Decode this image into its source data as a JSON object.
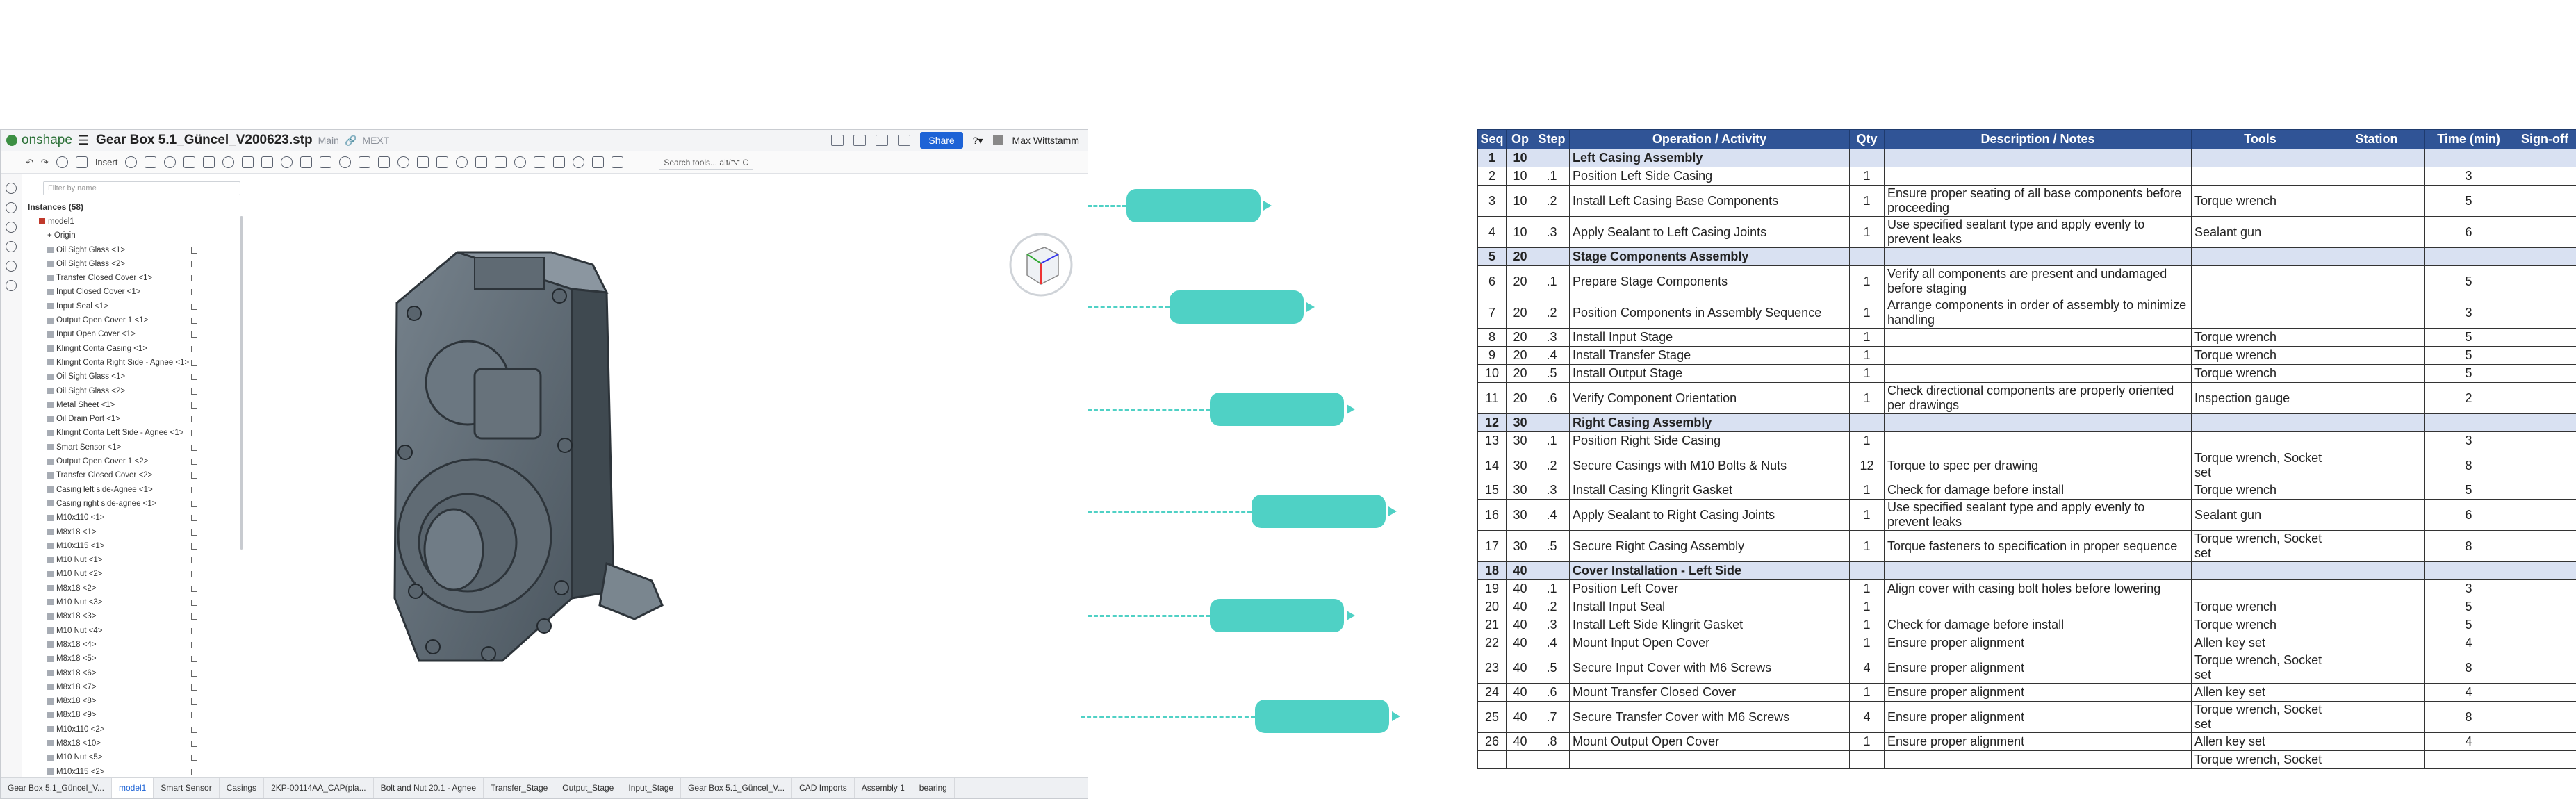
{
  "onshape": {
    "logo_text": "onshape",
    "doc_title": "Gear Box 5.1_Güncel_V200623.stp",
    "branch": "Main",
    "badge": "MEXT",
    "share": "Share",
    "user": "Max Wittstamm",
    "insert": "Insert",
    "search_tools": "Search tools...",
    "search_shortcut": "alt/⌥ C",
    "filter_placeholder": "Filter by name",
    "instances_label": "Instances (58)",
    "root": "model1",
    "origin": "Origin",
    "tree": [
      "Oil Sight Glass <1>",
      "Oil Sight Glass <2>",
      "Transfer Closed Cover <1>",
      "Input Closed Cover <1>",
      "Input Seal <1>",
      "Output Open Cover 1 <1>",
      "Input Open Cover <1>",
      "Klingrit Conta Casing <1>",
      "Klingrit Conta Right Side - Agnee <1>",
      "Oil Sight Glass <1>",
      "Oil Sight Glass <2>",
      "Metal Sheet <1>",
      "Oil Drain Port <1>",
      "Klingrit Conta Left Side - Agnee <1>",
      "Smart Sensor <1>",
      "Output Open Cover 1 <2>",
      "Transfer Closed Cover <2>",
      "Casing left side-Agnee <1>",
      "Casing right side-agnee <1>",
      "M10x110 <1>",
      "M8x18 <1>",
      "M10x115 <1>",
      "M10 Nut <1>",
      "M10 Nut <2>",
      "M8x18 <2>",
      "M10 Nut <3>",
      "M8x18 <3>",
      "M10 Nut <4>",
      "M8x18 <4>",
      "M8x18 <5>",
      "M8x18 <6>",
      "M8x18 <7>",
      "M8x18 <8>",
      "M8x18 <9>",
      "M10x110 <2>",
      "M8x18 <10>",
      "M10 Nut <5>",
      "M10x115 <2>"
    ],
    "tabs": [
      "Gear Box 5.1_Güncel_V...",
      "model1",
      "Smart Sensor",
      "Casings",
      "2KP-00114AA_CAP(pla...",
      "Bolt and Nut 20.1 - Agnee",
      "Transfer_Stage",
      "Output_Stage",
      "Input_Stage",
      "Gear Box 5.1_Güncel_V...",
      "CAD Imports",
      "Assembly 1",
      "bearing"
    ]
  },
  "table": {
    "headers": [
      "Seq",
      "Op",
      "Step",
      "Operation / Activity",
      "Qty",
      "Description / Notes",
      "Tools",
      "Station",
      "Time (min)",
      "Sign-off"
    ],
    "rows": [
      {
        "section": true,
        "seq": "1",
        "op": "10",
        "step": "",
        "activity": "Left Casing Assembly",
        "qty": "",
        "desc": "",
        "tools": "",
        "station": "",
        "time": "",
        "sign": ""
      },
      {
        "seq": "2",
        "op": "10",
        "step": ".1",
        "activity": "Position Left Side Casing",
        "qty": "1",
        "desc": "",
        "tools": "",
        "station": "",
        "time": "3",
        "sign": ""
      },
      {
        "seq": "3",
        "op": "10",
        "step": ".2",
        "activity": "Install Left Casing Base Components",
        "qty": "1",
        "desc": "Ensure proper seating of all base components before proceeding",
        "tools": "Torque wrench",
        "station": "",
        "time": "5",
        "sign": ""
      },
      {
        "seq": "4",
        "op": "10",
        "step": ".3",
        "activity": "Apply Sealant to Left Casing Joints",
        "qty": "1",
        "desc": "Use specified sealant type and apply evenly to prevent leaks",
        "tools": "Sealant gun",
        "station": "",
        "time": "6",
        "sign": ""
      },
      {
        "section": true,
        "seq": "5",
        "op": "20",
        "step": "",
        "activity": "Stage Components Assembly",
        "qty": "",
        "desc": "",
        "tools": "",
        "station": "",
        "time": "",
        "sign": ""
      },
      {
        "seq": "6",
        "op": "20",
        "step": ".1",
        "activity": "Prepare Stage Components",
        "qty": "1",
        "desc": "Verify all components are present and undamaged before staging",
        "tools": "",
        "station": "",
        "time": "5",
        "sign": ""
      },
      {
        "seq": "7",
        "op": "20",
        "step": ".2",
        "activity": "Position Components in Assembly Sequence",
        "qty": "1",
        "desc": "Arrange components in order of assembly to minimize handling",
        "tools": "",
        "station": "",
        "time": "3",
        "sign": ""
      },
      {
        "seq": "8",
        "op": "20",
        "step": ".3",
        "activity": "Install Input Stage",
        "qty": "1",
        "desc": "",
        "tools": "Torque wrench",
        "station": "",
        "time": "5",
        "sign": ""
      },
      {
        "seq": "9",
        "op": "20",
        "step": ".4",
        "activity": "Install Transfer Stage",
        "qty": "1",
        "desc": "",
        "tools": "Torque wrench",
        "station": "",
        "time": "5",
        "sign": ""
      },
      {
        "seq": "10",
        "op": "20",
        "step": ".5",
        "activity": "Install Output Stage",
        "qty": "1",
        "desc": "",
        "tools": "Torque wrench",
        "station": "",
        "time": "5",
        "sign": ""
      },
      {
        "seq": "11",
        "op": "20",
        "step": ".6",
        "activity": "Verify Component Orientation",
        "qty": "1",
        "desc": "Check directional components are properly oriented per drawings",
        "tools": "Inspection gauge",
        "station": "",
        "time": "2",
        "sign": ""
      },
      {
        "section": true,
        "seq": "12",
        "op": "30",
        "step": "",
        "activity": "Right Casing Assembly",
        "qty": "",
        "desc": "",
        "tools": "",
        "station": "",
        "time": "",
        "sign": ""
      },
      {
        "seq": "13",
        "op": "30",
        "step": ".1",
        "activity": "Position Right Side Casing",
        "qty": "1",
        "desc": "",
        "tools": "",
        "station": "",
        "time": "3",
        "sign": ""
      },
      {
        "seq": "14",
        "op": "30",
        "step": ".2",
        "activity": "Secure Casings with M10 Bolts & Nuts",
        "qty": "12",
        "desc": "Torque to spec per drawing",
        "tools": "Torque wrench, Socket set",
        "station": "",
        "time": "8",
        "sign": ""
      },
      {
        "seq": "15",
        "op": "30",
        "step": ".3",
        "activity": "Install Casing Klingrit Gasket",
        "qty": "1",
        "desc": "Check for damage before install",
        "tools": "Torque wrench",
        "station": "",
        "time": "5",
        "sign": ""
      },
      {
        "seq": "16",
        "op": "30",
        "step": ".4",
        "activity": "Apply Sealant to Right Casing Joints",
        "qty": "1",
        "desc": "Use specified sealant type and apply evenly to prevent leaks",
        "tools": "Sealant gun",
        "station": "",
        "time": "6",
        "sign": ""
      },
      {
        "seq": "17",
        "op": "30",
        "step": ".5",
        "activity": "Secure Right Casing Assembly",
        "qty": "1",
        "desc": "Torque fasteners to specification in proper sequence",
        "tools": "Torque wrench, Socket set",
        "station": "",
        "time": "8",
        "sign": ""
      },
      {
        "section": true,
        "seq": "18",
        "op": "40",
        "step": "",
        "activity": "Cover Installation - Left Side",
        "qty": "",
        "desc": "",
        "tools": "",
        "station": "",
        "time": "",
        "sign": ""
      },
      {
        "seq": "19",
        "op": "40",
        "step": ".1",
        "activity": "Position Left Cover",
        "qty": "1",
        "desc": "Align cover with casing bolt holes before lowering",
        "tools": "",
        "station": "",
        "time": "3",
        "sign": ""
      },
      {
        "seq": "20",
        "op": "40",
        "step": ".2",
        "activity": "Install Input Seal",
        "qty": "1",
        "desc": "",
        "tools": "Torque wrench",
        "station": "",
        "time": "5",
        "sign": ""
      },
      {
        "seq": "21",
        "op": "40",
        "step": ".3",
        "activity": "Install Left Side Klingrit Gasket",
        "qty": "1",
        "desc": "Check for damage before install",
        "tools": "Torque wrench",
        "station": "",
        "time": "5",
        "sign": ""
      },
      {
        "seq": "22",
        "op": "40",
        "step": ".4",
        "activity": "Mount Input Open Cover",
        "qty": "1",
        "desc": "Ensure proper alignment",
        "tools": "Allen key set",
        "station": "",
        "time": "4",
        "sign": ""
      },
      {
        "seq": "23",
        "op": "40",
        "step": ".5",
        "activity": "Secure Input Cover with M6 Screws",
        "qty": "4",
        "desc": "Ensure proper alignment",
        "tools": "Torque wrench, Socket set",
        "station": "",
        "time": "8",
        "sign": ""
      },
      {
        "seq": "24",
        "op": "40",
        "step": ".6",
        "activity": "Mount Transfer Closed Cover",
        "qty": "1",
        "desc": "Ensure proper alignment",
        "tools": "Allen key set",
        "station": "",
        "time": "4",
        "sign": ""
      },
      {
        "seq": "25",
        "op": "40",
        "step": ".7",
        "activity": "Secure Transfer Cover with M6 Screws",
        "qty": "4",
        "desc": "Ensure proper alignment",
        "tools": "Torque wrench, Socket set",
        "station": "",
        "time": "8",
        "sign": ""
      },
      {
        "seq": "26",
        "op": "40",
        "step": ".8",
        "activity": "Mount Output Open Cover",
        "qty": "1",
        "desc": "Ensure proper alignment",
        "tools": "Allen key set",
        "station": "",
        "time": "4",
        "sign": ""
      },
      {
        "seq": "",
        "op": "",
        "step": "",
        "activity": "",
        "qty": "",
        "desc": "",
        "tools": "Torque wrench, Socket",
        "station": "",
        "time": "",
        "sign": ""
      }
    ]
  },
  "colors": {
    "header_bg": "#305496",
    "section_bg": "#d9e1f2",
    "connector": "#4fd1c5",
    "model": "#5b6670"
  }
}
